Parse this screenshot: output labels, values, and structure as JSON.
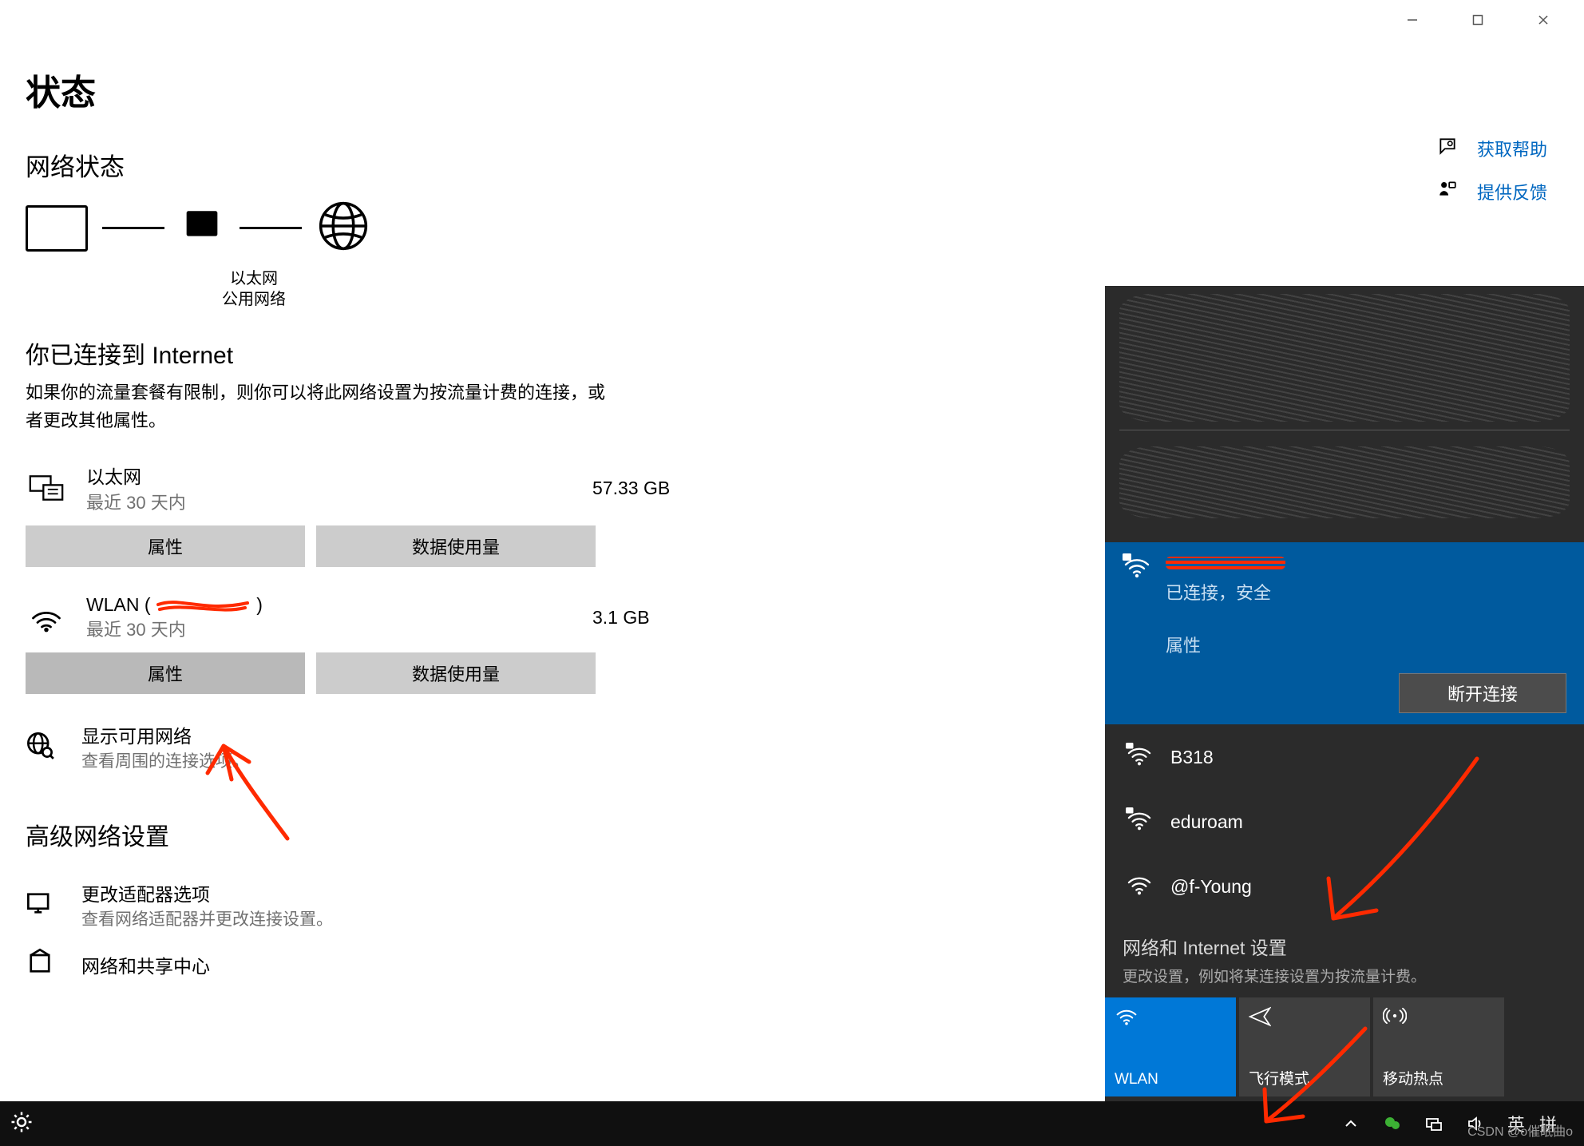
{
  "window": {
    "minimize": "—",
    "maximize": "▢",
    "close": "✕"
  },
  "page_title": "状态",
  "network_status_heading": "网络状态",
  "diagram": {
    "ethernet_label_1": "以太网",
    "ethernet_label_2": "公用网络"
  },
  "connected_heading": "你已连接到 Internet",
  "connected_desc": "如果你的流量套餐有限制，则你可以将此网络设置为按流量计费的连接，或者更改其他属性。",
  "networks": [
    {
      "name": "以太网",
      "sub": "最近 30 天内",
      "usage": "57.33 GB",
      "btn_props": "属性",
      "btn_usage": "数据使用量",
      "icon": "ethernet"
    },
    {
      "name": "WLAN (",
      "sub": "最近 30 天内",
      "usage": "3.1 GB",
      "btn_props": "属性",
      "btn_usage": "数据使用量",
      "icon": "wifi"
    }
  ],
  "show_networks": {
    "title": "显示可用网络",
    "sub": "查看周围的连接选项。"
  },
  "advanced_heading": "高级网络设置",
  "adapter_options": {
    "title": "更改适配器选项",
    "sub": "查看网络适配器并更改连接设置。"
  },
  "sharing_center": {
    "title": "网络和共享中心"
  },
  "help": {
    "get_help": "获取帮助",
    "feedback": "提供反馈"
  },
  "flyout": {
    "connected": {
      "status": "已连接，安全",
      "properties": "属性",
      "disconnect": "断开连接"
    },
    "items": [
      {
        "name": "B318",
        "secured": true
      },
      {
        "name": "eduroam",
        "secured": true
      },
      {
        "name": "@f-Young",
        "secured": false
      }
    ],
    "settings_title": "网络和 Internet 设置",
    "settings_sub": "更改设置，例如将某连接设置为按流量计费。",
    "tiles": {
      "wlan": "WLAN",
      "airplane": "飞行模式",
      "hotspot": "移动热点"
    }
  },
  "taskbar": {
    "ime_lang": "英",
    "ime_mode": "拼"
  },
  "watermark": "CSDN @o催眠曲o"
}
